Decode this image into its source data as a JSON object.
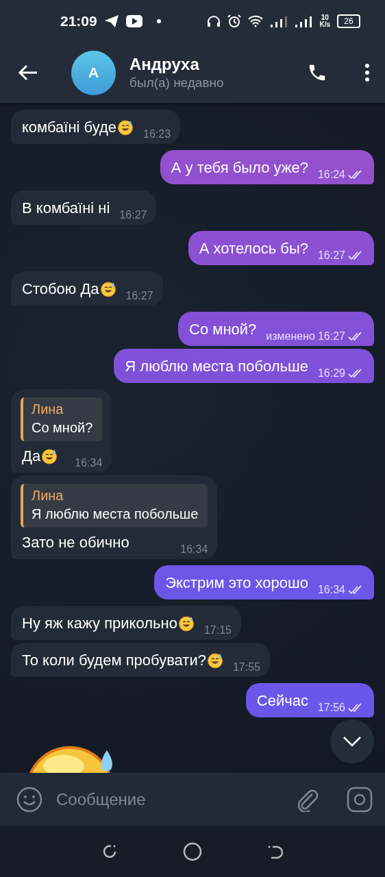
{
  "status_bar": {
    "time": "21:09",
    "net_speed_value": "10",
    "net_speed_unit": "K/s",
    "battery": "26"
  },
  "header": {
    "avatar_letter": "А",
    "name": "Андруха",
    "status": "был(а) недавно"
  },
  "messages": [
    {
      "kind": "in",
      "text": "комбаїні буде",
      "emoji": true,
      "time": "16:23"
    },
    {
      "kind": "out",
      "text": "А у тебя было уже?",
      "time": "16:24",
      "read": true
    },
    {
      "kind": "in",
      "text": "В комбаїні ні",
      "emoji": false,
      "time": "16:27"
    },
    {
      "kind": "out",
      "text": "А хотелось бы?",
      "time": "16:27",
      "read": true
    },
    {
      "kind": "in",
      "text": "Стобою Да",
      "emoji": true,
      "time": "16:27"
    },
    {
      "kind": "out",
      "text": "Со мной?",
      "edited": "изменено",
      "time": "16:27",
      "read": true
    },
    {
      "kind": "out",
      "text": "Я люблю места побольше",
      "time": "16:29",
      "read": true
    },
    {
      "kind": "in",
      "reply": {
        "name": "Лина",
        "text": "Со мной?"
      },
      "text": "Да",
      "emoji": true,
      "time": "16:34"
    },
    {
      "kind": "in",
      "reply": {
        "name": "Лина",
        "text": "Я люблю места побольше"
      },
      "text": "Зато не обично",
      "emoji": false,
      "time": "16:34"
    },
    {
      "kind": "out",
      "text": "Экстрим это хорошо",
      "time": "16:34",
      "read": true
    },
    {
      "kind": "in",
      "text": "Ну яж кажу прикольно ",
      "emoji": true,
      "time": "17:15"
    },
    {
      "kind": "in",
      "text": "То коли будем пробувати?",
      "emoji": true,
      "time": "17:55"
    },
    {
      "kind": "out",
      "text": "Сейчас",
      "time": "17:56",
      "read": true
    }
  ],
  "composer": {
    "placeholder": "Сообщение"
  }
}
